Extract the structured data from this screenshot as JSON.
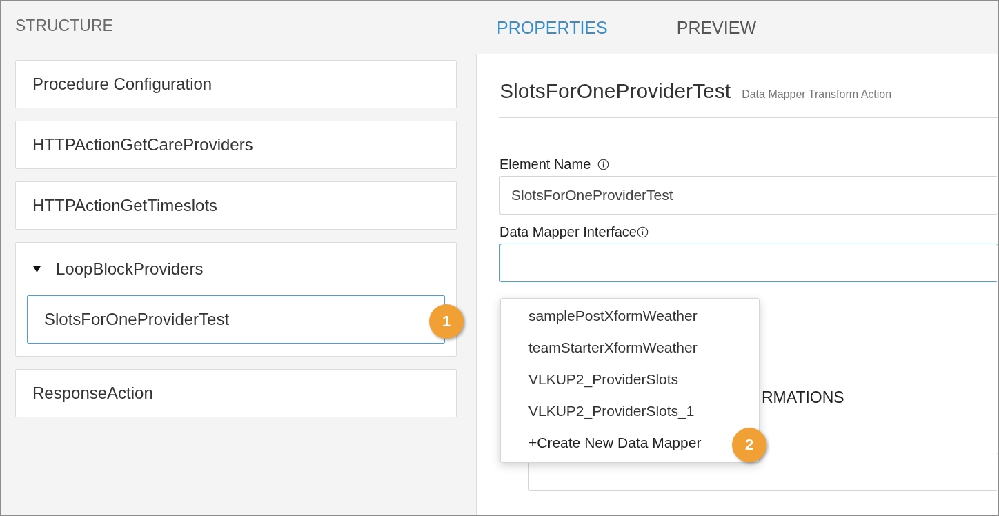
{
  "structure": {
    "title": "STRUCTURE",
    "items": [
      {
        "label": "Procedure Configuration"
      },
      {
        "label": "HTTPActionGetCareProviders"
      },
      {
        "label": "HTTPActionGetTimeslots"
      },
      {
        "label": "LoopBlockProviders",
        "expanded": true,
        "children": [
          {
            "label": "SlotsForOneProviderTest",
            "selected": true,
            "callout": "1"
          }
        ]
      },
      {
        "label": "ResponseAction"
      }
    ]
  },
  "tabs": [
    {
      "label": "PROPERTIES",
      "selected": true
    },
    {
      "label": "PREVIEW",
      "selected": false
    }
  ],
  "properties": {
    "title": "SlotsForOneProviderTest",
    "subtitle": "Data Mapper Transform Action",
    "fields": [
      {
        "label": "Element Name",
        "info": true,
        "value": "SlotsForOneProviderTest",
        "focused": false
      },
      {
        "label": "Data Mapper Interface",
        "info": true,
        "focused": true
      }
    ],
    "dropdown": {
      "options": [
        {
          "label": "samplePostXformWeather",
          "kind": "option"
        },
        {
          "label": "teamStarterXformWeather",
          "kind": "option"
        },
        {
          "label": "VLKUP2_ProviderSlots",
          "kind": "option"
        },
        {
          "label": "VLKUP2_ProviderSlots_1",
          "kind": "option"
        },
        {
          "label": "+Create New Data Mapper",
          "kind": "create",
          "callout": "2"
        }
      ]
    },
    "section_title": "RMATIONS"
  }
}
